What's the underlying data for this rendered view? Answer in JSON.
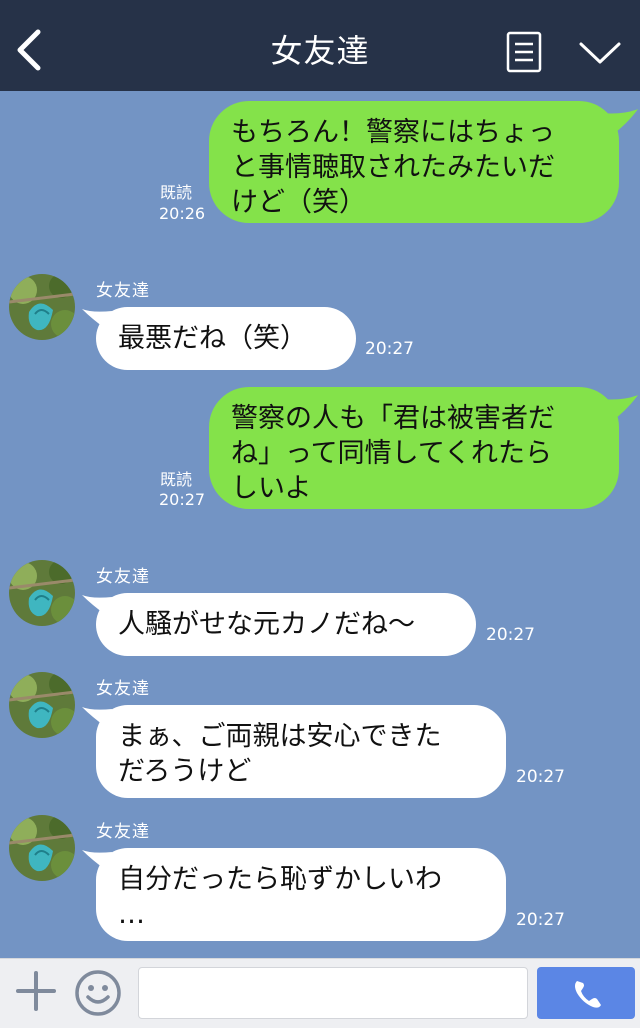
{
  "header": {
    "title": "女友達"
  },
  "messages": [
    {
      "side": "sent",
      "lines": [
        "もちろん！警察にはちょっ",
        "と事情聴取されたみたいだ",
        "けど（笑）"
      ],
      "read": "既読",
      "time": "20:26"
    },
    {
      "side": "recv",
      "sender": "女友達",
      "lines": [
        "最悪だね（笑）"
      ],
      "time": "20:27"
    },
    {
      "side": "sent",
      "lines": [
        "警察の人も「君は被害者だ",
        "ね」って同情してくれたら",
        "しいよ"
      ],
      "read": "既読",
      "time": "20:27"
    },
    {
      "side": "recv",
      "sender": "女友達",
      "lines": [
        "人騒がせな元カノだね〜"
      ],
      "time": "20:27"
    },
    {
      "side": "recv",
      "sender": "女友達",
      "lines": [
        "まぁ、ご両親は安心できた",
        "だろうけど"
      ],
      "time": "20:27"
    },
    {
      "side": "recv",
      "sender": "女友達",
      "lines": [
        "自分だったら恥ずかしいわ",
        "…"
      ],
      "time": "20:27"
    }
  ],
  "footer": {
    "input_value": "",
    "input_placeholder": ""
  },
  "colors": {
    "background": "#7394c4",
    "header": "#263248",
    "sent_bubble": "#84e24a",
    "recv_bubble": "#ffffff",
    "call_button": "#5b86e5"
  },
  "icons": [
    "back-arrow-icon",
    "menu-list-icon",
    "chevron-down-icon",
    "plus-icon",
    "smiley-icon",
    "phone-icon"
  ]
}
